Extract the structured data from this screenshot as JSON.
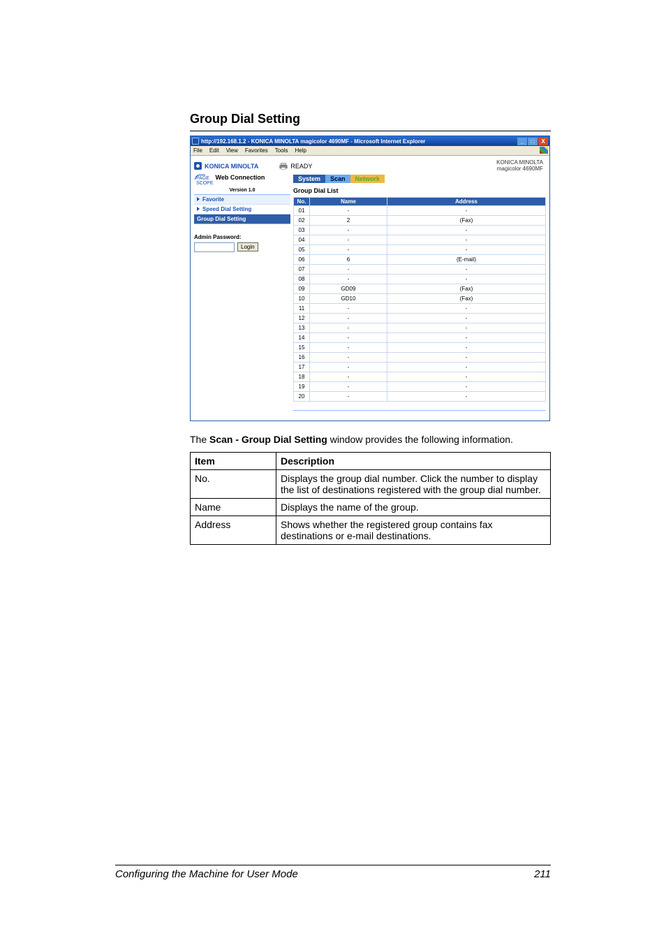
{
  "heading": "Group Dial Setting",
  "ie": {
    "title": "http://192.168.1.2 - KONICA MINOLTA magicolor 4690MF - Microsoft Internet Explorer",
    "menus": [
      "File",
      "Edit",
      "View",
      "Favorites",
      "Tools",
      "Help"
    ],
    "win_min": "_",
    "win_max": "□",
    "win_close": "X"
  },
  "app": {
    "brand": "KONICA MINOLTA",
    "status": "READY",
    "right_brand_line1": "KONICA MINOLTA",
    "right_brand_line2": "magicolor 4690MF",
    "pagescope_small": "PAGE\nSCOPE",
    "pagescope_label": "Web Connection",
    "version": "Version 1.0",
    "tabs": {
      "system": "System",
      "scan": "Scan",
      "network": "Network"
    },
    "content_title": "Group Dial List",
    "nav": {
      "favorite": "Favorite",
      "speed": "Speed Dial Setting",
      "group": "Group Dial Setting"
    },
    "admin": {
      "label": "Admin Password:",
      "login": "Login"
    },
    "table": {
      "headers": {
        "no": "No.",
        "name": "Name",
        "address": "Address"
      },
      "rows": [
        {
          "no": "01",
          "name": "-",
          "address": "-"
        },
        {
          "no": "02",
          "name": "2",
          "address": "(Fax)"
        },
        {
          "no": "03",
          "name": "-",
          "address": "-"
        },
        {
          "no": "04",
          "name": "-",
          "address": "-"
        },
        {
          "no": "05",
          "name": "-",
          "address": "-"
        },
        {
          "no": "06",
          "name": "6",
          "address": "(E-mail)"
        },
        {
          "no": "07",
          "name": "-",
          "address": "-"
        },
        {
          "no": "08",
          "name": "-",
          "address": "-"
        },
        {
          "no": "09",
          "name": "GD09",
          "address": "(Fax)"
        },
        {
          "no": "10",
          "name": "GD10",
          "address": "(Fax)"
        },
        {
          "no": "11",
          "name": "-",
          "address": "-"
        },
        {
          "no": "12",
          "name": "-",
          "address": "-"
        },
        {
          "no": "13",
          "name": "-",
          "address": "-"
        },
        {
          "no": "14",
          "name": "-",
          "address": "-"
        },
        {
          "no": "15",
          "name": "-",
          "address": "-"
        },
        {
          "no": "16",
          "name": "-",
          "address": "-"
        },
        {
          "no": "17",
          "name": "-",
          "address": "-"
        },
        {
          "no": "18",
          "name": "-",
          "address": "-"
        },
        {
          "no": "19",
          "name": "-",
          "address": "-"
        },
        {
          "no": "20",
          "name": "-",
          "address": "-"
        }
      ]
    }
  },
  "para": {
    "pre": "The ",
    "strong": "Scan - Group Dial Setting",
    "post": " window provides the following information."
  },
  "desc": {
    "headers": {
      "item": "Item",
      "description": "Description"
    },
    "rows": [
      {
        "item": "No.",
        "desc": "Displays the group dial number. Click the number to display the list of destinations registered with the group dial number."
      },
      {
        "item": "Name",
        "desc": "Displays the name of the group."
      },
      {
        "item": "Address",
        "desc": "Shows whether the registered group contains fax destinations or e-mail destinations."
      }
    ]
  },
  "footer": {
    "left": "Configuring the Machine for User Mode",
    "right": "211"
  }
}
